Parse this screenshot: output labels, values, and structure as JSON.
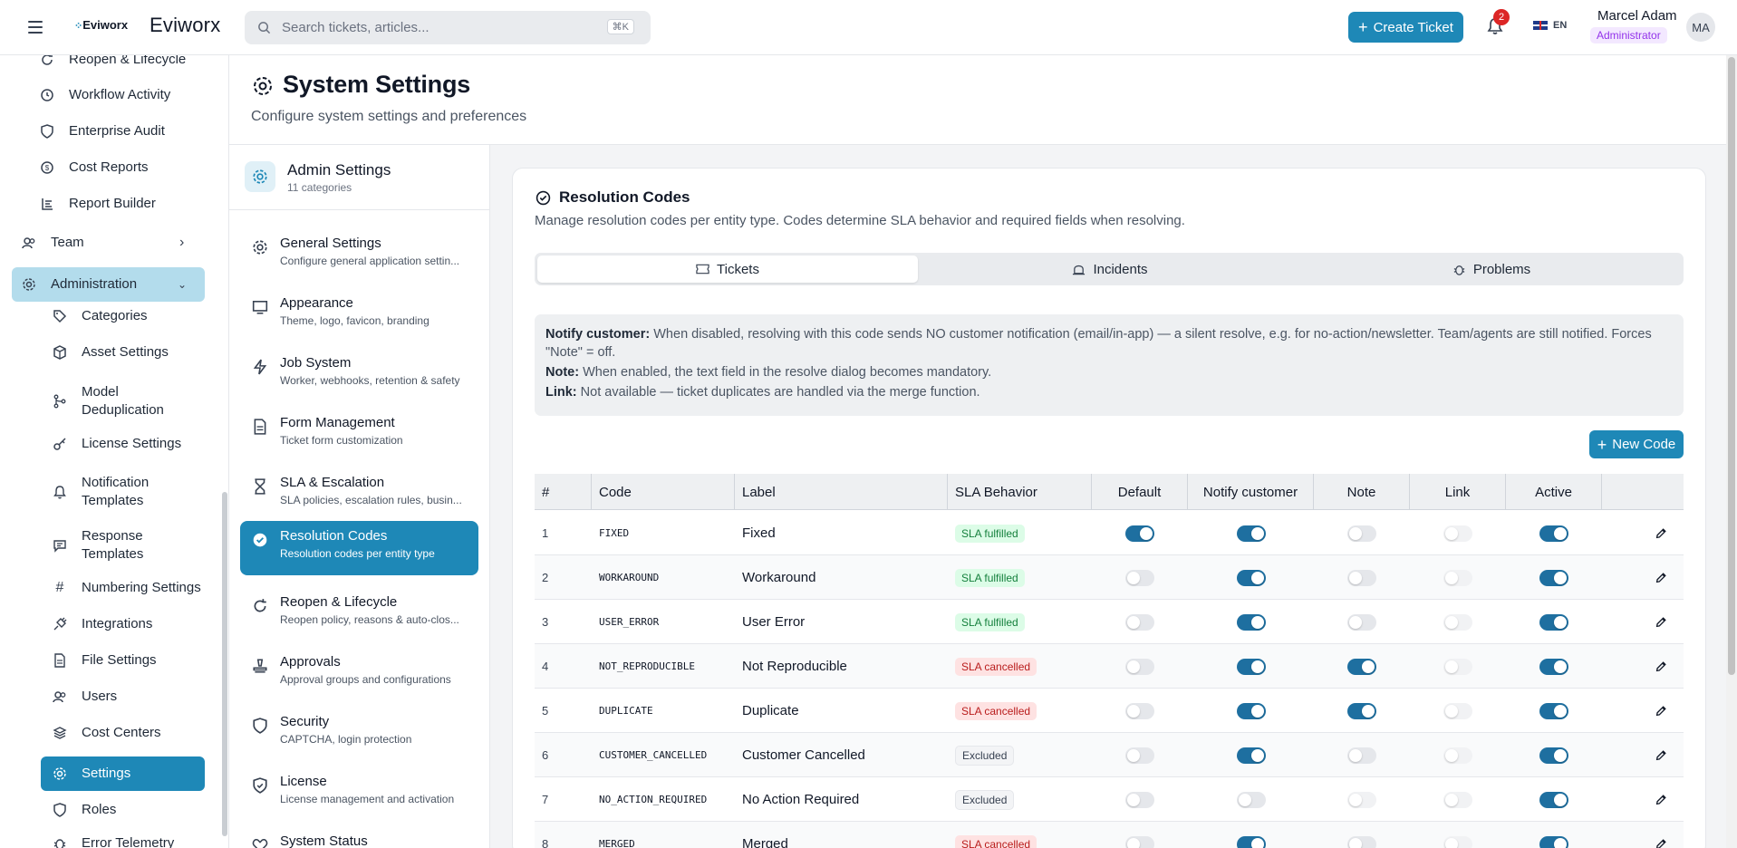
{
  "app": {
    "logo_small": "Eviworx",
    "logo_big": "Eviworx"
  },
  "search": {
    "placeholder": "Search tickets, articles...",
    "shortcut": "⌘K"
  },
  "header": {
    "create_ticket": "Create Ticket",
    "notification_count": "2",
    "language": "EN",
    "user_name": "Marcel Adam",
    "user_role": "Administrator",
    "avatar_initials": "MA"
  },
  "leftnav": {
    "items": [
      {
        "label": "Reopen & Lifecycle",
        "icon": "refresh-icon"
      },
      {
        "label": "Workflow Activity",
        "icon": "history-icon"
      },
      {
        "label": "Enterprise Audit",
        "icon": "shield-icon"
      },
      {
        "label": "Cost Reports",
        "icon": "coin-icon"
      },
      {
        "label": "Report Builder",
        "icon": "report-icon"
      }
    ],
    "team": "Team",
    "administration": "Administration",
    "admin_items": [
      {
        "label": "Categories",
        "icon": "tag-icon"
      },
      {
        "label": "Asset Settings",
        "icon": "box-icon"
      },
      {
        "label": "Model Deduplication",
        "icon": "merge-icon"
      },
      {
        "label": "License Settings",
        "icon": "key-icon"
      },
      {
        "label": "Notification Templates",
        "icon": "bell-icon"
      },
      {
        "label": "Response Templates",
        "icon": "message-icon"
      },
      {
        "label": "Numbering Settings",
        "icon": "hash-icon"
      },
      {
        "label": "Integrations",
        "icon": "plug-icon"
      },
      {
        "label": "File Settings",
        "icon": "file-icon"
      },
      {
        "label": "Users",
        "icon": "users-icon"
      },
      {
        "label": "Cost Centers",
        "icon": "layers-icon"
      },
      {
        "label": "Settings",
        "icon": "gear-icon"
      },
      {
        "label": "Roles",
        "icon": "shield-icon"
      },
      {
        "label": "Error Telemetry",
        "icon": "bug-icon"
      }
    ]
  },
  "page": {
    "title": "System Settings",
    "subtitle": "Configure system settings and preferences"
  },
  "settings_panel": {
    "title": "Admin Settings",
    "count": "11 categories",
    "items": [
      {
        "title": "General Settings",
        "desc": "Configure general application settin..."
      },
      {
        "title": "Appearance",
        "desc": "Theme, logo, favicon, branding"
      },
      {
        "title": "Job System",
        "desc": "Worker, webhooks, retention & safety"
      },
      {
        "title": "Form Management",
        "desc": "Ticket form customization"
      },
      {
        "title": "SLA & Escalation",
        "desc": "SLA policies, escalation rules, busin..."
      },
      {
        "title": "Resolution Codes",
        "desc": "Resolution codes per entity type"
      },
      {
        "title": "Reopen & Lifecycle",
        "desc": "Reopen policy, reasons & auto-clos..."
      },
      {
        "title": "Approvals",
        "desc": "Approval groups and configurations"
      },
      {
        "title": "Security",
        "desc": "CAPTCHA, login protection"
      },
      {
        "title": "License",
        "desc": "License management and activation"
      },
      {
        "title": "System Status",
        "desc": ""
      }
    ]
  },
  "card": {
    "title": "Resolution Codes",
    "description": "Manage resolution codes per entity type. Codes determine SLA behavior and required fields when resolving.",
    "tabs": [
      "Tickets",
      "Incidents",
      "Problems"
    ],
    "info": {
      "notify_label": "Notify customer:",
      "notify_text": "When disabled, resolving with this code sends NO customer notification (email/in-app) — a silent resolve, e.g. for no-action/newsletter. Team/agents are still notified. Forces \"Note\" = off.",
      "note_label": "Note:",
      "note_text": "When enabled, the text field in the resolve dialog becomes mandatory.",
      "link_label": "Link:",
      "link_text": "Not available — ticket duplicates are handled via the merge function."
    },
    "new_code": "New Code"
  },
  "table": {
    "headers": [
      "#",
      "Code",
      "Label",
      "SLA Behavior",
      "Default",
      "Notify customer",
      "Note",
      "Link",
      "Active"
    ],
    "rows": [
      {
        "n": "1",
        "code": "FIXED",
        "label": "Fixed",
        "sla": "SLA fulfilled",
        "sla_type": "green",
        "default": true,
        "notify": true,
        "note": false,
        "link": false,
        "active": true
      },
      {
        "n": "2",
        "code": "WORKAROUND",
        "label": "Workaround",
        "sla": "SLA fulfilled",
        "sla_type": "green",
        "default": false,
        "notify": true,
        "note": false,
        "link": false,
        "active": true
      },
      {
        "n": "3",
        "code": "USER_ERROR",
        "label": "User Error",
        "sla": "SLA fulfilled",
        "sla_type": "green",
        "default": false,
        "notify": true,
        "note": false,
        "link": false,
        "active": true
      },
      {
        "n": "4",
        "code": "NOT_REPRODUCIBLE",
        "label": "Not Reproducible",
        "sla": "SLA cancelled",
        "sla_type": "red",
        "default": false,
        "notify": true,
        "note": true,
        "link": false,
        "active": true
      },
      {
        "n": "5",
        "code": "DUPLICATE",
        "label": "Duplicate",
        "sla": "SLA cancelled",
        "sla_type": "red",
        "default": false,
        "notify": true,
        "note": true,
        "link": false,
        "active": true
      },
      {
        "n": "6",
        "code": "CUSTOMER_CANCELLED",
        "label": "Customer Cancelled",
        "sla": "Excluded",
        "sla_type": "gray",
        "default": false,
        "notify": true,
        "note": false,
        "link": false,
        "active": true
      },
      {
        "n": "7",
        "code": "NO_ACTION_REQUIRED",
        "label": "No Action Required",
        "sla": "Excluded",
        "sla_type": "gray",
        "default": false,
        "notify": false,
        "note": false,
        "link": false,
        "active": true
      },
      {
        "n": "8",
        "code": "MERGED",
        "label": "Merged",
        "sla": "SLA cancelled",
        "sla_type": "red",
        "default": false,
        "notify": true,
        "note": false,
        "link": false,
        "active": true
      }
    ]
  },
  "colors": {
    "accent": "#1e88b7",
    "toggle_on": "#1e6fa0",
    "admin_bg": "#b3dcec"
  }
}
